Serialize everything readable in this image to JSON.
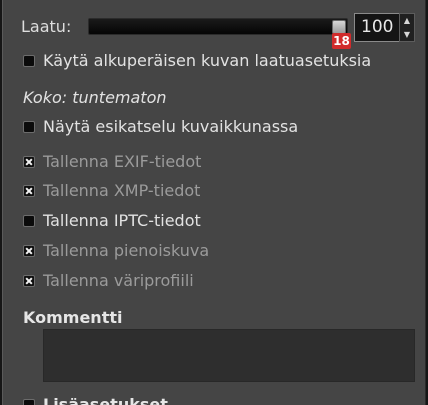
{
  "quality": {
    "label": "Laatu:",
    "value": "100",
    "slider_fraction": 1.0,
    "badge": "18",
    "spin_up_icon": "▲",
    "spin_down_icon": "▼"
  },
  "options": [
    {
      "label": "Käytä alkuperäisen kuvan laatuasetuksia",
      "checked": false,
      "enabled": true
    },
    {
      "label": "Näytä esikatselu kuvaikkunassa",
      "checked": false,
      "enabled": true
    }
  ],
  "size_text": "Koko: tuntematon",
  "metadata": [
    {
      "label": "Tallenna EXIF-tiedot",
      "checked": true,
      "enabled": false
    },
    {
      "label": "Tallenna XMP-tiedot",
      "checked": true,
      "enabled": false
    },
    {
      "label": "Tallenna IPTC-tiedot",
      "checked": false,
      "enabled": true
    },
    {
      "label": "Tallenna pienoiskuva",
      "checked": true,
      "enabled": false
    },
    {
      "label": "Tallenna väriprofiili",
      "checked": true,
      "enabled": false
    }
  ],
  "comment": {
    "title": "Kommentti",
    "value": ""
  },
  "advanced": {
    "label": "Lisäasetukset"
  },
  "colors": {
    "panel": "#454545",
    "badge": "#d12b2b",
    "dim_text": "#9b9b9b"
  }
}
